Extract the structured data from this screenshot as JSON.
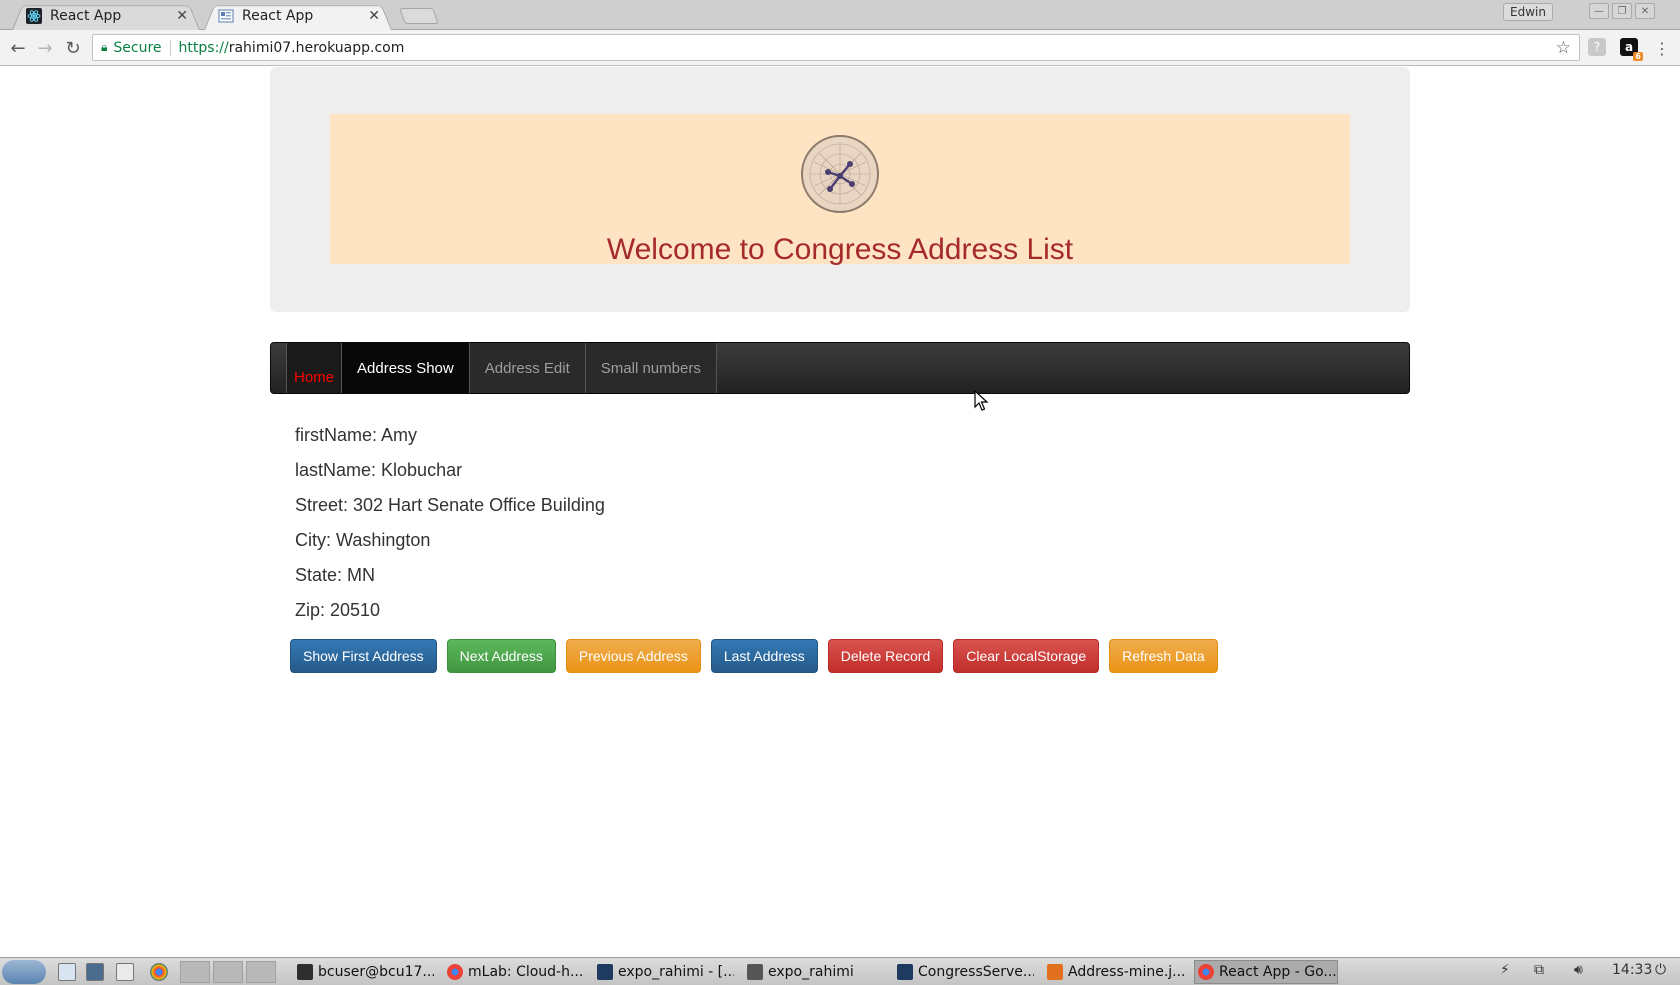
{
  "browser": {
    "tabs": [
      {
        "title": "React App",
        "active": false
      },
      {
        "title": "React App",
        "active": true
      }
    ],
    "user": "Edwin",
    "security_label": "Secure",
    "url_scheme": "https://",
    "url_host": "rahimi07.herokuapp.com",
    "extension_badge": "6"
  },
  "page": {
    "welcome": "Welcome to Congress Address List",
    "nav": {
      "home": "Home",
      "address_show": "Address Show",
      "address_edit": "Address Edit",
      "small_numbers": "Small numbers"
    },
    "record": {
      "first_name": "firstName: Amy",
      "last_name": "lastName: Klobuchar",
      "street": "Street: 302 Hart Senate Office Building",
      "city": "City: Washington",
      "state": "State: MN",
      "zip": "Zip: 20510"
    },
    "buttons": {
      "show_first": "Show First Address",
      "next": "Next Address",
      "previous": "Previous Address",
      "last": "Last Address",
      "delete": "Delete Record",
      "clear_storage": "Clear LocalStorage",
      "refresh": "Refresh Data"
    }
  },
  "taskbar": {
    "tasks": [
      "bcuser@bcu17...",
      "mLab: Cloud-h...",
      "expo_rahimi - [...",
      "expo_rahimi",
      "CongressServe...",
      "Address-mine.j...",
      "React App - Go..."
    ],
    "clock": "14:33"
  },
  "colors": {
    "welcome_text": "#a52a2a",
    "header_bg": "#ffe4c4",
    "nav_home": "#ff0000"
  }
}
